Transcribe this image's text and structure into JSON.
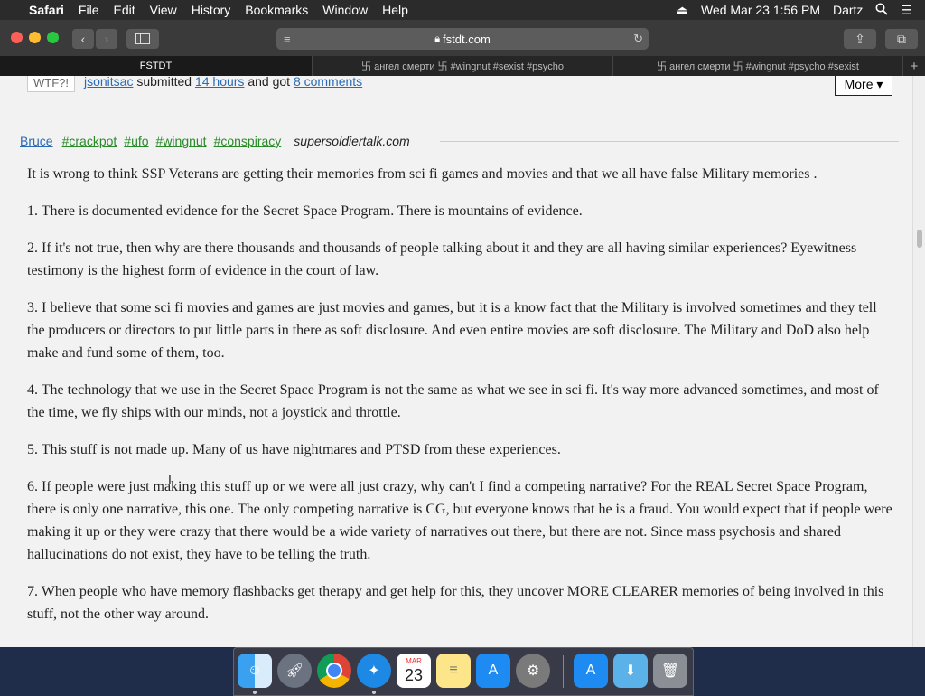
{
  "menubar": {
    "apple": "",
    "app_name": "Safari",
    "menus": [
      "File",
      "Edit",
      "View",
      "History",
      "Bookmarks",
      "Window",
      "Help"
    ],
    "datetime": "Wed Mar 23  1:56 PM",
    "user": "Dartz"
  },
  "toolbar": {
    "url": "fstdt.com"
  },
  "tabs": [
    {
      "label": "FSTDT"
    },
    {
      "label": "卐 ангел смерти 卐 #wingnut #sexist #psycho"
    },
    {
      "label": "卐 ангел смерти 卐 #wingnut #psycho #sexist"
    }
  ],
  "previous_post": {
    "badge": "WTF?!",
    "user": "jsonitsac",
    "submitted": "submitted",
    "time": "14 hours",
    "got": "and got",
    "comments": "8 comments",
    "more": "More ▾"
  },
  "post": {
    "author": "Bruce",
    "tags": [
      "#crackpot",
      "#ufo",
      "#wingnut",
      "#conspiracy"
    ],
    "site": "supersoldiertalk.com",
    "paragraphs": [
      "It is wrong to think SSP Veterans are getting their memories from sci fi games and movies and that we all have false Military memories .",
      "1. There is documented evidence for the Secret Space Program. There is mountains of evidence.",
      "2. If it's not true, then why are there thousands and thousands of people talking about it and they are all having similar experiences? Eyewitness testimony is the highest form of evidence in the court of law.",
      "3. I believe that some sci fi movies and games are just movies and games, but it is a know fact that the Military is involved sometimes and they tell the producers or directors to put little parts in there as soft disclosure. And even entire movies are soft disclosure. The Military and DoD also help make and fund some of them, too.",
      "4. The technology that we use in the Secret Space Program is not the same as what we see in sci fi. It's way more advanced sometimes, and most of the time, we fly ships with our minds, not a joystick and throttle.",
      "5. This stuff is not made up. Many of us have nightmares and PTSD from these experiences.",
      "6. If people were just making this stuff up or we were all just crazy, why can't I find a competing narrative? For the REAL Secret Space Program, there is only one narrative, this one. The only competing narrative is CG, but everyone knows that he is a fraud. You would expect that if people were making it up or they were crazy that there would be a wide variety of narratives out there, but there are not. Since mass psychosis and shared hallucinations do not exist, they have to be telling the truth.",
      "7. When people who have memory flashbacks get therapy and get help for this, they uncover MORE CLEARER memories of being involved in this stuff, not the other way around."
    ]
  },
  "dock": {
    "calendar_month": "MAR",
    "calendar_day": "23"
  }
}
